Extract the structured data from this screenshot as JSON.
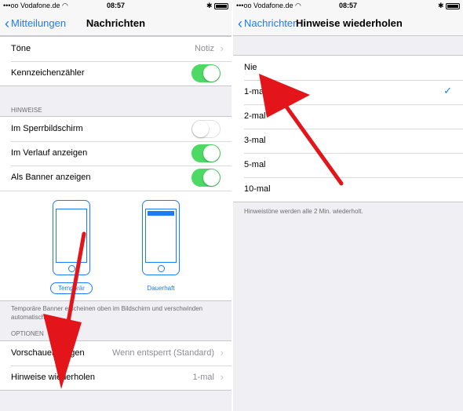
{
  "left": {
    "status": {
      "carrier": "Vodafone.de",
      "time": "08:57"
    },
    "nav": {
      "back": "Mitteilungen",
      "title": "Nachrichten"
    },
    "group1": {
      "rows": [
        {
          "label": "Töne",
          "value": "Notiz"
        },
        {
          "label": "Kennzeichenzähler",
          "switch_on": true
        }
      ]
    },
    "hinweise_header": "HINWEISE",
    "hinweise_rows": [
      {
        "label": "Im Sperrbildschirm",
        "switch_on": false
      },
      {
        "label": "Im Verlauf anzeigen",
        "switch_on": true
      },
      {
        "label": "Als Banner anzeigen",
        "switch_on": true
      }
    ],
    "banner_styles": {
      "temporary": "Temporär",
      "persistent": "Dauerhaft",
      "selected": "temporary"
    },
    "banner_footer": "Temporäre Banner erscheinen oben im Bildschirm und verschwinden automatisch.",
    "optionen_header": "OPTIONEN",
    "optionen_rows": [
      {
        "label": "Vorschauen zeigen",
        "value": "Wenn entsperrt (Standard)"
      },
      {
        "label": "Hinweise wiederholen",
        "value": "1-mal"
      }
    ]
  },
  "right": {
    "status": {
      "carrier": "Vodafone.de",
      "time": "08:57"
    },
    "nav": {
      "back": "Nachrichten",
      "title": "Hinweise wiederholen"
    },
    "options": [
      "Nie",
      "1-mal",
      "2-mal",
      "3-mal",
      "5-mal",
      "10-mal"
    ],
    "selected": "1-mal",
    "footer": "Hinweistöne werden alle 2 Min. wiederholt."
  },
  "colors": {
    "accent": "#1c7cf6",
    "switch_on": "#4cd964",
    "arrow": "#e3151a",
    "background": "#efeff4"
  }
}
